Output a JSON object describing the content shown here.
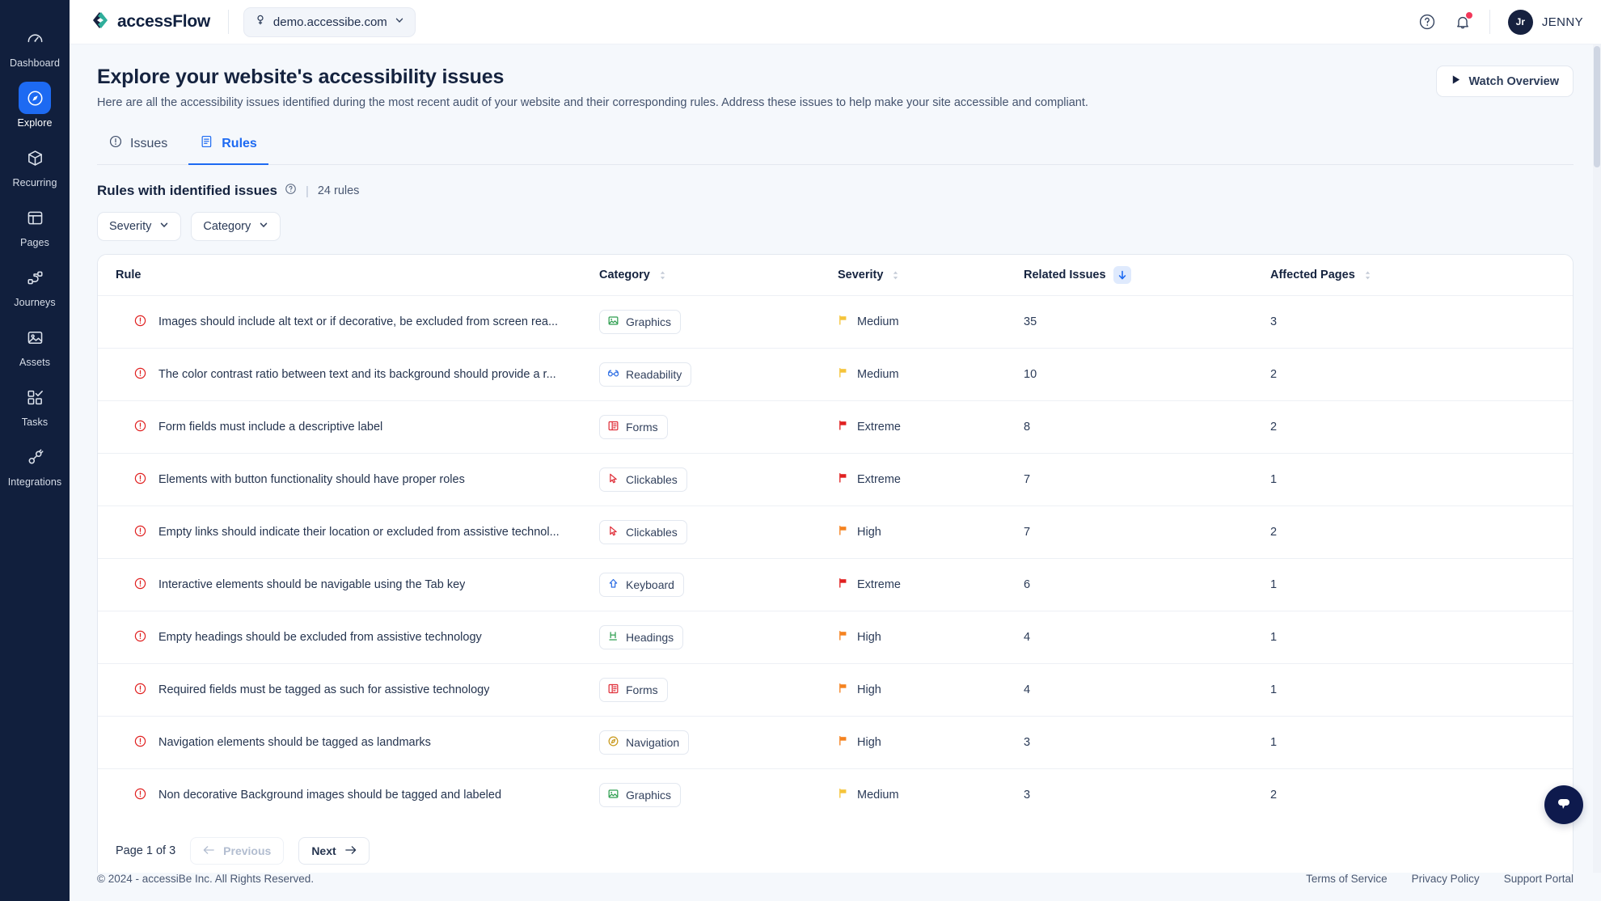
{
  "topbar": {
    "brand_name": "accessFlow",
    "brand_logo_icon": "accessflow-logo-icon",
    "site_selector": {
      "icon": "globe-icon",
      "value": "demo.accessibe.com",
      "chevron": "chevron-down-icon"
    },
    "help_icon": "help-circle-icon",
    "notifications_icon": "bell-icon",
    "notification_badge": true,
    "user": {
      "initials": "Jr",
      "name": "JENNY"
    }
  },
  "sidebar": {
    "items": [
      {
        "label": "Dashboard",
        "icon": "gauge-icon",
        "active": false
      },
      {
        "label": "Explore",
        "icon": "compass-icon",
        "active": true
      },
      {
        "label": "Recurring",
        "icon": "cube-icon",
        "active": false
      },
      {
        "label": "Pages",
        "icon": "layout-icon",
        "active": false
      },
      {
        "label": "Journeys",
        "icon": "journey-icon",
        "active": false
      },
      {
        "label": "Assets",
        "icon": "image-icon",
        "active": false
      },
      {
        "label": "Tasks",
        "icon": "tasks-icon",
        "active": false
      },
      {
        "label": "Integrations",
        "icon": "plug-icon",
        "active": false
      }
    ]
  },
  "page": {
    "title": "Explore your website's accessibility issues",
    "subtitle": "Here are all the accessibility issues identified during the most recent audit of your website and their corresponding rules. Address these issues to help make your site accessible and compliant.",
    "watch_overview_label": "Watch Overview",
    "watch_overview_icon": "play-icon"
  },
  "tabs": [
    {
      "label": "Issues",
      "icon": "alert-circle-icon",
      "active": false
    },
    {
      "label": "Rules",
      "icon": "rules-doc-icon",
      "active": true
    }
  ],
  "section": {
    "title": "Rules with identified issues",
    "info_icon": "help-circle-icon",
    "divider": "|",
    "count_label": "24 rules"
  },
  "filters": [
    {
      "label": "Severity",
      "icon": "chevron-down-icon"
    },
    {
      "label": "Category",
      "icon": "chevron-down-icon"
    }
  ],
  "table": {
    "columns": [
      {
        "label": "Rule",
        "sortable": false,
        "sort_state": "none"
      },
      {
        "label": "Category",
        "sortable": true,
        "sort_state": "none"
      },
      {
        "label": "Severity",
        "sortable": true,
        "sort_state": "none"
      },
      {
        "label": "Related Issues",
        "sortable": true,
        "sort_state": "desc"
      },
      {
        "label": "Affected Pages",
        "sortable": true,
        "sort_state": "none"
      }
    ],
    "rows": [
      {
        "status_icon": "error-circle-icon",
        "rule": "Images should include alt text or if decorative, be excluded from screen rea...",
        "category": "Graphics",
        "category_icon": "image-icon",
        "category_color": "#2e9e4f",
        "severity": "Medium",
        "severity_color": "#f5c43a",
        "related_issues": "35",
        "affected_pages": "3"
      },
      {
        "status_icon": "error-circle-icon",
        "rule": "The color contrast ratio between text and its background should provide a r...",
        "category": "Readability",
        "category_icon": "glasses-icon",
        "category_color": "#2f6fe4",
        "severity": "Medium",
        "severity_color": "#f5c43a",
        "related_issues": "10",
        "affected_pages": "2"
      },
      {
        "status_icon": "error-circle-icon",
        "rule": "Form fields must include a descriptive label",
        "category": "Forms",
        "category_icon": "form-icon",
        "category_color": "#e0323c",
        "severity": "Extreme",
        "severity_color": "#e02020",
        "related_issues": "8",
        "affected_pages": "2"
      },
      {
        "status_icon": "error-circle-icon",
        "rule": "Elements with button functionality should have proper roles",
        "category": "Clickables",
        "category_icon": "cursor-icon",
        "category_color": "#e0323c",
        "severity": "Extreme",
        "severity_color": "#e02020",
        "related_issues": "7",
        "affected_pages": "1"
      },
      {
        "status_icon": "error-circle-icon",
        "rule": "Empty links should indicate their location or excluded from assistive technol...",
        "category": "Clickables",
        "category_icon": "cursor-icon",
        "category_color": "#e0323c",
        "severity": "High",
        "severity_color": "#f5821f",
        "related_issues": "7",
        "affected_pages": "2"
      },
      {
        "status_icon": "error-circle-icon",
        "rule": "Interactive elements should be navigable using the Tab key",
        "category": "Keyboard",
        "category_icon": "shift-key-icon",
        "category_color": "#2f6fe4",
        "severity": "Extreme",
        "severity_color": "#e02020",
        "related_issues": "6",
        "affected_pages": "1"
      },
      {
        "status_icon": "error-circle-icon",
        "rule": "Empty headings should be excluded from assistive technology",
        "category": "Headings",
        "category_icon": "heading-icon",
        "category_color": "#2e9e4f",
        "severity": "High",
        "severity_color": "#f5821f",
        "related_issues": "4",
        "affected_pages": "1"
      },
      {
        "status_icon": "error-circle-icon",
        "rule": "Required fields must be tagged as such for assistive technology",
        "category": "Forms",
        "category_icon": "form-icon",
        "category_color": "#e0323c",
        "severity": "High",
        "severity_color": "#f5821f",
        "related_issues": "4",
        "affected_pages": "1"
      },
      {
        "status_icon": "error-circle-icon",
        "rule": "Navigation elements should be tagged as landmarks",
        "category": "Navigation",
        "category_icon": "compass-icon",
        "category_color": "#c99a1e",
        "severity": "High",
        "severity_color": "#f5821f",
        "related_issues": "3",
        "affected_pages": "1"
      },
      {
        "status_icon": "error-circle-icon",
        "rule": "Non decorative Background images should be tagged and labeled",
        "category": "Graphics",
        "category_icon": "image-icon",
        "category_color": "#2e9e4f",
        "severity": "Medium",
        "severity_color": "#f5c43a",
        "related_issues": "3",
        "affected_pages": "2"
      }
    ]
  },
  "pagination": {
    "page_label": "Page 1 of 3",
    "previous_label": "Previous",
    "previous_disabled": true,
    "next_label": "Next",
    "prev_icon": "arrow-left-icon",
    "next_icon": "arrow-right-icon"
  },
  "footer": {
    "copyright": "© 2024 - accessiBe Inc. All Rights Reserved.",
    "links": [
      "Terms of Service",
      "Privacy Policy",
      "Support Portal"
    ]
  },
  "chat": {
    "icon": "chat-bubble-icon"
  },
  "colors": {
    "accent": "#1d6af2",
    "sidebar_bg": "#111f3d",
    "page_bg": "#f5f8fc",
    "severity_extreme": "#e02020",
    "severity_high": "#f5821f",
    "severity_medium": "#f5c43a",
    "error_icon": "#e02020"
  }
}
